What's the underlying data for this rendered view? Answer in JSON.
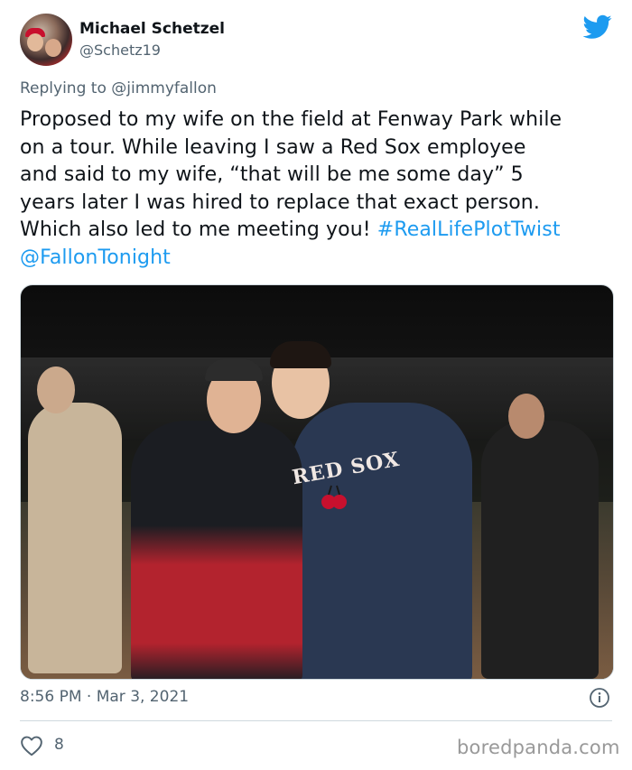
{
  "author": {
    "display_name": "Michael Schetzel",
    "handle": "@Schetz19"
  },
  "reply": {
    "prefix": "Replying to",
    "mention": "@jimmyfallon"
  },
  "tweet": {
    "lines": [
      "Proposed to my wife on the field at Fenway Park while",
      "on a tour.  While leaving I saw a Red Sox employee",
      "and said to my wife, “that will be me some day” 5",
      "years later I was hired to replace that exact person.",
      "Which also led to me meeting you! "
    ],
    "hashtag": "#RealLifePlotTwist",
    "mention": "@FallonTonight"
  },
  "media": {
    "jersey_text": "RED SOX"
  },
  "meta": {
    "timestamp": "8:56 PM · Mar 3, 2021",
    "like_count": "8"
  },
  "watermark": "boredpanda.com",
  "icons": {
    "brand": "twitter-bird-icon",
    "info": "info-icon",
    "like": "heart-icon"
  },
  "colors": {
    "link": "#1d9bf0",
    "secondary_text": "#536471",
    "brand": "#1d9bf0"
  }
}
